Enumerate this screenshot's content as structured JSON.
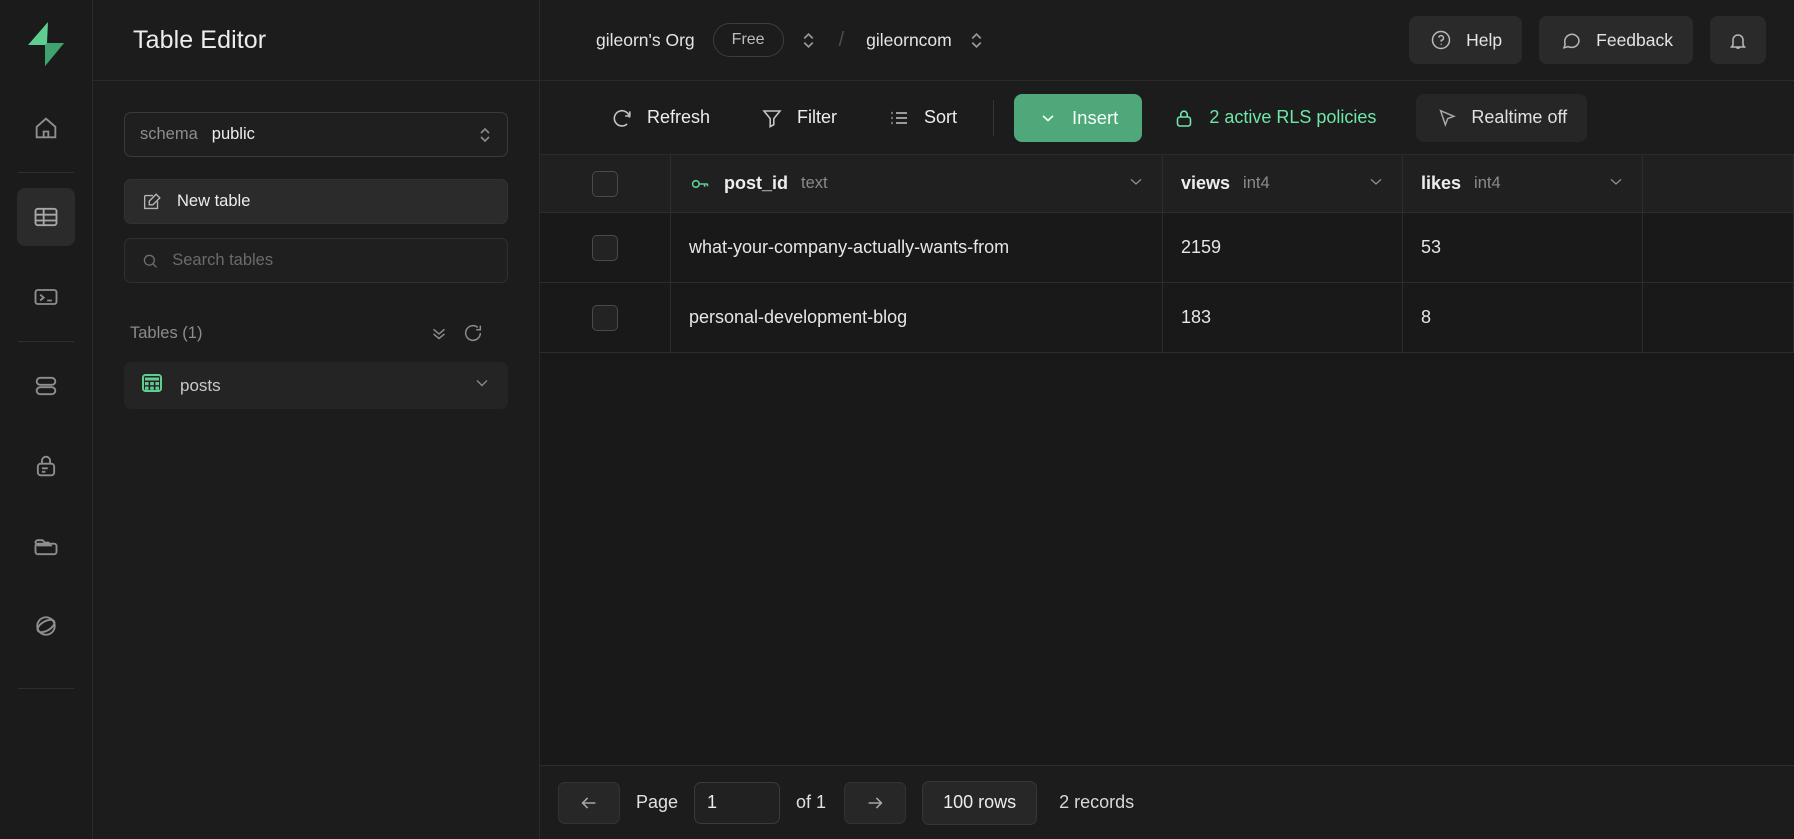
{
  "rail": {
    "logo_icon": "supabase-logo",
    "items": [
      {
        "icon": "home-icon",
        "name": "home",
        "active": false
      },
      {
        "icon": "table-editor-icon",
        "name": "table-editor",
        "active": true
      },
      {
        "icon": "sql-editor-icon",
        "name": "sql-editor",
        "active": false
      },
      {
        "icon": "database-icon",
        "name": "database",
        "active": false
      },
      {
        "icon": "auth-lock-icon",
        "name": "authentication",
        "active": false
      },
      {
        "icon": "storage-folder-icon",
        "name": "storage",
        "active": false
      },
      {
        "icon": "edge-functions-icon",
        "name": "edge-functions",
        "active": false
      }
    ]
  },
  "panel": {
    "title": "Table Editor",
    "schema": {
      "label": "schema",
      "value": "public",
      "icon": "chevron-up-down-icon"
    },
    "new_table": {
      "label": "New table",
      "icon": "new-table-pencil-icon"
    },
    "search": {
      "placeholder": "Search tables",
      "value": "",
      "icon": "search-icon"
    },
    "tables_header": {
      "label": "Tables (1)",
      "collapse_icon": "chevrons-down-icon",
      "refresh_icon": "refresh-icon"
    },
    "tables": [
      {
        "name": "posts",
        "icon": "table-grid-icon",
        "chevron": "chevron-down-icon"
      }
    ]
  },
  "topbar": {
    "org": "gileorn's Org",
    "plan": "Free",
    "org_switcher_icon": "chevron-up-down-icon",
    "separator": "/",
    "project": "gileorncom",
    "project_switcher_icon": "chevron-up-down-icon",
    "help": {
      "label": "Help",
      "icon": "help-circle-icon"
    },
    "feedback": {
      "label": "Feedback",
      "icon": "message-bubble-icon"
    },
    "notifications": {
      "icon": "bell-icon"
    }
  },
  "toolbar": {
    "refresh": {
      "label": "Refresh",
      "icon": "refresh-icon"
    },
    "filter": {
      "label": "Filter",
      "icon": "funnel-icon"
    },
    "sort": {
      "label": "Sort",
      "icon": "sort-list-icon"
    },
    "insert": {
      "label": "Insert",
      "icon": "chevron-down-icon"
    },
    "rls": {
      "label": "2 active RLS policies",
      "icon": "lock-icon",
      "color": "#6ee7a8"
    },
    "realtime": {
      "label": "Realtime off",
      "icon": "cursor-pointer-icon"
    }
  },
  "grid": {
    "columns": [
      {
        "name": "post_id",
        "type": "text",
        "is_primary_key": true,
        "key_icon": "key-icon",
        "menu_icon": "chevron-down-icon"
      },
      {
        "name": "views",
        "type": "int4",
        "is_primary_key": false,
        "menu_icon": "chevron-down-icon"
      },
      {
        "name": "likes",
        "type": "int4",
        "is_primary_key": false,
        "menu_icon": "chevron-down-icon"
      }
    ],
    "rows": [
      {
        "post_id": "what-your-company-actually-wants-from",
        "views": "2159",
        "likes": "53"
      },
      {
        "post_id": "personal-development-blog",
        "views": "183",
        "likes": "8"
      }
    ]
  },
  "footer": {
    "prev_icon": "arrow-left-icon",
    "next_icon": "arrow-right-icon",
    "page_label": "Page",
    "page_value": "1",
    "of_label": "of 1",
    "rows_per_page": "100 rows",
    "records": "2 records"
  },
  "colors": {
    "accent_green": "#4fa87a",
    "rls_green": "#6ee7a8",
    "background": "#1c1c1c",
    "grid_background": "#191919"
  }
}
